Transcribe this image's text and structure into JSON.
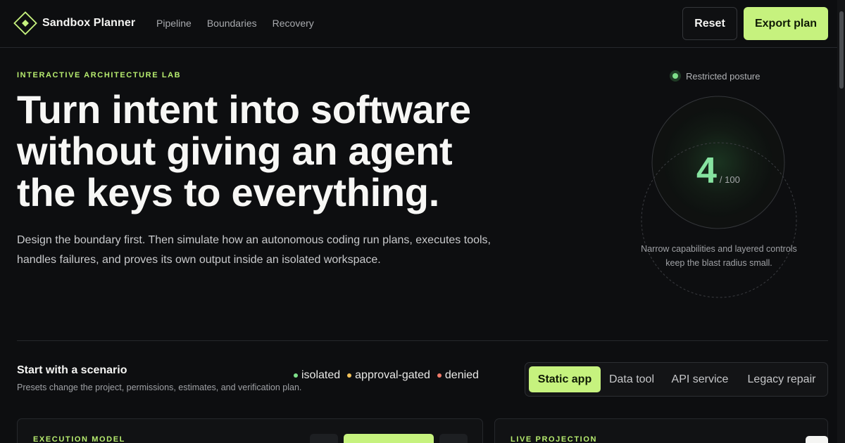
{
  "header": {
    "brand": "Sandbox Planner",
    "nav": [
      "Pipeline",
      "Boundaries",
      "Recovery"
    ],
    "reset_label": "Reset",
    "export_label": "Export plan"
  },
  "hero": {
    "eyebrow": "INTERACTIVE ARCHITECTURE LAB",
    "title_lines": [
      "Turn intent into software",
      "without giving an agent",
      "the keys to everything."
    ],
    "subtitle_lines": [
      "Design the boundary first. Then simulate how an autonomous coding run plans, executes tools,",
      "handles failures, and proves its own output inside an isolated workspace."
    ]
  },
  "gauge": {
    "posture_label": "Restricted posture",
    "score": "4",
    "score_max": "/ 100",
    "caption_lines": [
      "Narrow capabilities and layered controls",
      "keep the blast radius small."
    ]
  },
  "scenario": {
    "title": "Start with a scenario",
    "subtitle": "Presets change the project, permissions, estimates, and verification plan.",
    "legend": [
      {
        "label": "isolated",
        "color": "#7ee08a"
      },
      {
        "label": "approval-gated",
        "color": "#f2c15a"
      },
      {
        "label": "denied",
        "color": "#f07b6a"
      }
    ],
    "tabs": [
      "Static app",
      "Data tool",
      "API service",
      "Legacy repair"
    ],
    "active_tab": "Static app"
  },
  "panels": {
    "left_label": "EXECUTION MODEL",
    "right_label": "LIVE PROJECTION"
  },
  "colors": {
    "accent": "#c6f27e",
    "background": "#0d0e10",
    "score": "#86e3a0"
  }
}
